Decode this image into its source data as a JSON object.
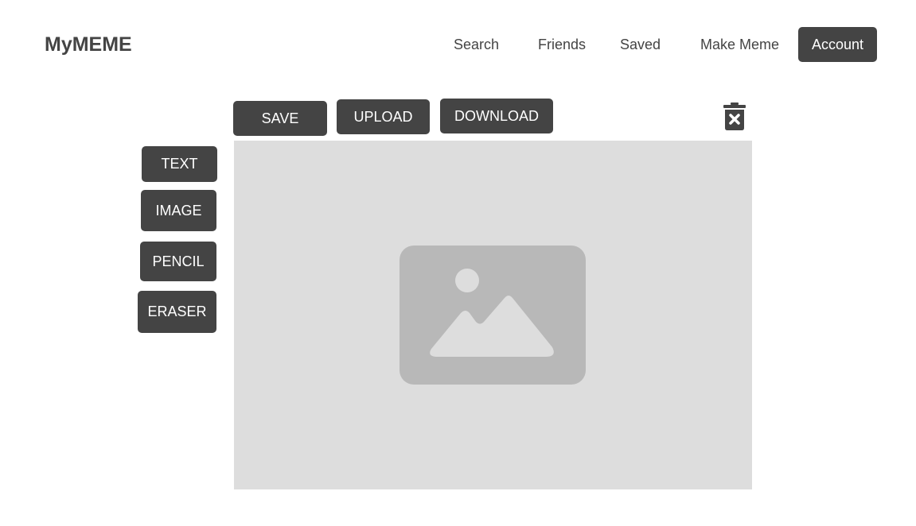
{
  "header": {
    "logo": "MyMEME",
    "nav": {
      "search": "Search",
      "friends": "Friends",
      "saved": "Saved",
      "make_meme": "Make Meme",
      "account": "Account"
    }
  },
  "toolbar": {
    "save": "SAVE",
    "upload": "UPLOAD",
    "download": "DOWNLOAD",
    "delete_icon": "trash-x-icon"
  },
  "tools": {
    "text": "TEXT",
    "image": "IMAGE",
    "pencil": "PENCIL",
    "eraser": "ERASER"
  },
  "canvas": {
    "placeholder_icon": "image-placeholder-icon"
  },
  "colors": {
    "button_bg": "#444444",
    "button_text": "#ffffff",
    "canvas_bg": "#dddddd",
    "placeholder": "#b8b8b8"
  }
}
